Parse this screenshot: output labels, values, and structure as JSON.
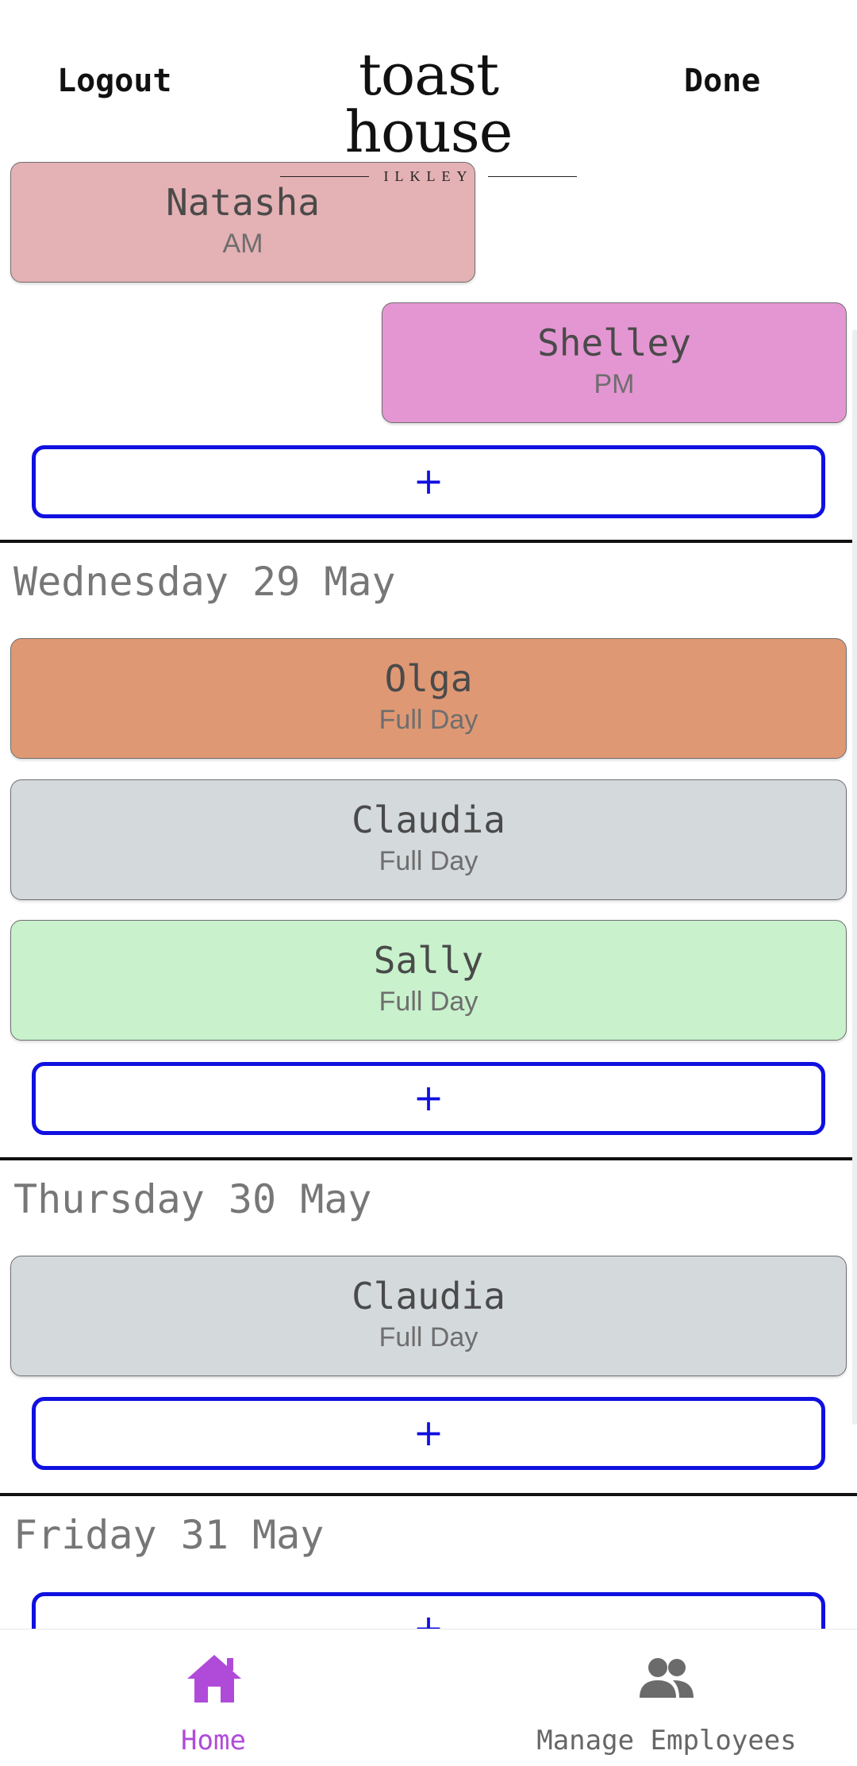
{
  "header": {
    "logout_label": "Logout",
    "done_label": "Done",
    "logo_main": "toast house",
    "logo_sub": "ILKLEY"
  },
  "days": [
    {
      "heading": "",
      "shifts": [
        {
          "name": "Natasha",
          "shift": "AM",
          "color": "#e4b1b4"
        },
        {
          "name": "Shelley",
          "shift": "PM",
          "color": "#e496d2"
        }
      ],
      "add_label": "+"
    },
    {
      "heading": "Wednesday 29 May",
      "shifts": [
        {
          "name": "Olga",
          "shift": "Full Day",
          "color": "#df9874"
        },
        {
          "name": "Claudia",
          "shift": "Full Day",
          "color": "#d4d9dc"
        },
        {
          "name": "Sally",
          "shift": "Full Day",
          "color": "#c8f1cc"
        }
      ],
      "add_label": "+"
    },
    {
      "heading": "Thursday 30 May",
      "shifts": [
        {
          "name": "Claudia",
          "shift": "Full Day",
          "color": "#d4d9dc"
        }
      ],
      "add_label": "+"
    },
    {
      "heading": "Friday 31 May",
      "shifts": [],
      "add_label": "+"
    }
  ],
  "bottom_nav": {
    "items": [
      {
        "label": "Home",
        "icon": "home-icon",
        "color": "#b04bd9",
        "active": true
      },
      {
        "label": "Manage Employees",
        "icon": "people-icon",
        "color": "#666666",
        "active": false
      }
    ]
  }
}
